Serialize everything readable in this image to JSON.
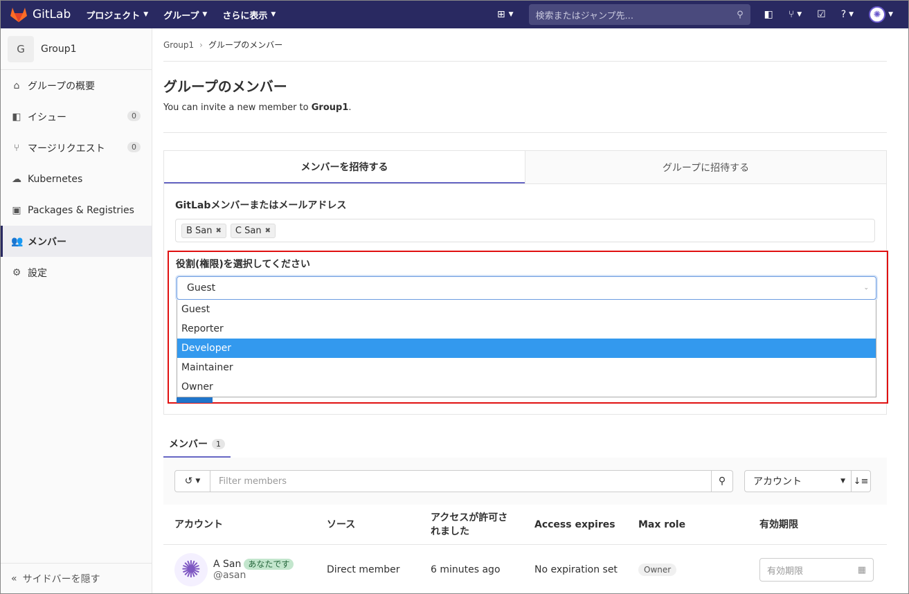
{
  "topbar": {
    "app_name": "GitLab",
    "nav": [
      "プロジェクト",
      "グループ",
      "さらに表示"
    ],
    "search_placeholder": "検索またはジャンプ先..."
  },
  "sidebar": {
    "group_initial": "G",
    "group_name": "Group1",
    "items": [
      {
        "label": "グループの概要",
        "icon": "home-icon"
      },
      {
        "label": "イシュー",
        "icon": "issues-icon",
        "count": "0"
      },
      {
        "label": "マージリクエスト",
        "icon": "merge-request-icon",
        "count": "0"
      },
      {
        "label": "Kubernetes",
        "icon": "kubernetes-icon"
      },
      {
        "label": "Packages & Registries",
        "icon": "package-icon"
      },
      {
        "label": "メンバー",
        "icon": "users-icon",
        "active": true
      },
      {
        "label": "設定",
        "icon": "settings-icon"
      }
    ],
    "collapse": "サイドバーを隠す"
  },
  "breadcrumb": {
    "parent": "Group1",
    "current": "グループのメンバー"
  },
  "page": {
    "title": "グループのメンバー",
    "sub_prefix": "You can invite a new member to ",
    "sub_group": "Group1",
    "sub_suffix": "."
  },
  "invite": {
    "tab_member": "メンバーを招待する",
    "tab_group": "グループに招待する",
    "member_label": "GitLabメンバーまたはメールアドレス",
    "tokens": [
      "B San",
      "C San"
    ],
    "role_label": "役割(権限)を選択してください",
    "role_selected": "Guest",
    "role_options": [
      "Guest",
      "Reporter",
      "Developer",
      "Maintainer",
      "Owner"
    ],
    "highlighted_option": "Developer"
  },
  "members": {
    "tab_label": "メンバー",
    "count": "1",
    "filter_placeholder": "Filter members",
    "sort_label": "アカウント",
    "columns": [
      "アカウント",
      "ソース",
      "アクセスが許可されました",
      "Access expires",
      "Max role",
      "有効期限"
    ],
    "rows": [
      {
        "name": "A San",
        "you_badge": "あなたです",
        "username": "@asan",
        "source": "Direct member",
        "granted": "6 minutes ago",
        "expires": "No expiration set",
        "role": "Owner",
        "date_placeholder": "有効期限"
      }
    ]
  },
  "colors": {
    "topbar": "#292961",
    "highlight": "#3399ee",
    "annotation_box": "#e01010"
  }
}
